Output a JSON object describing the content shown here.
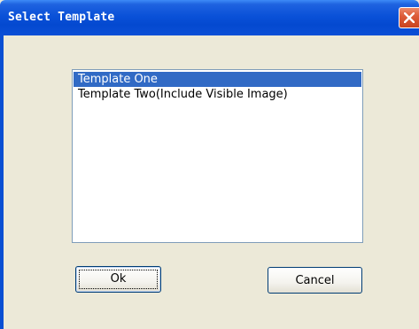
{
  "window": {
    "title": "Select Template",
    "close_icon": "close-icon"
  },
  "listbox": {
    "items": [
      {
        "label": "Template One",
        "selected": true
      },
      {
        "label": "Template Two(Include Visible Image)",
        "selected": false
      }
    ]
  },
  "buttons": {
    "ok_label": "Ok",
    "cancel_label": "Cancel"
  },
  "colors": {
    "titlebar": "#0a51d8",
    "selection": "#316ac5",
    "close_button": "#dd5c3a",
    "dialog_background": "#ece9d8"
  }
}
